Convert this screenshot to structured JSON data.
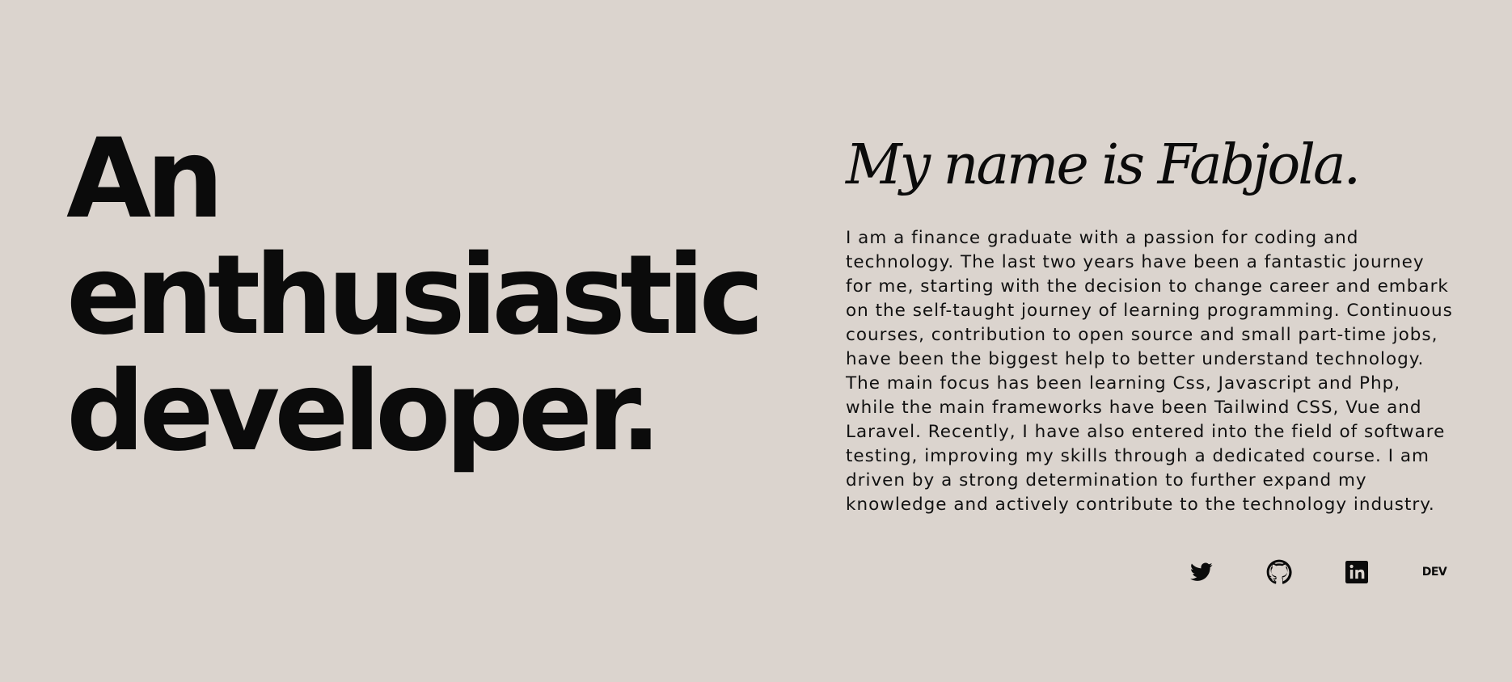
{
  "hero": {
    "lines": [
      "An",
      "enthusiastic",
      "developer."
    ]
  },
  "about": {
    "heading": "My name is Fabjola.",
    "bio": "I am a finance graduate with a passion for coding and technology. The last two years have been a fantastic journey for me, starting with the decision to change career and embark on the self-taught journey of learning programming. Continuous courses, contribution to open source and small part-time jobs, have been the biggest help to better understand technology. The main focus has been learning Css, Javascript and Php, while the main frameworks have been Tailwind CSS, Vue and Laravel. Recently, I have also entered into the field of software testing, improving my skills through a dedicated course. I am driven by a strong determination to further expand my knowledge and actively contribute to the technology industry."
  },
  "socials": [
    {
      "icon": "twitter-icon"
    },
    {
      "icon": "github-icon"
    },
    {
      "icon": "linkedin-icon"
    },
    {
      "icon": "dev-icon",
      "label": "DEV"
    }
  ],
  "colors": {
    "background": "#dbd4ce",
    "text": "#0b0b0b"
  }
}
